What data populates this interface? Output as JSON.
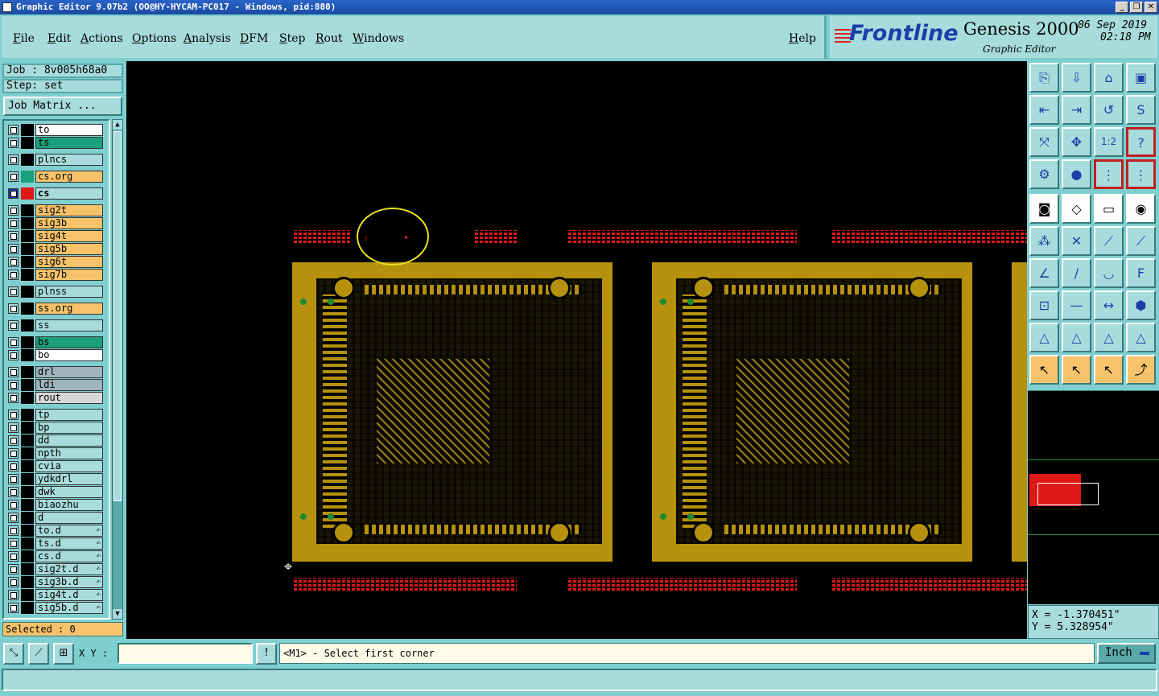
{
  "window": {
    "title": "Graphic Editor 9.07b2 (OO@HY-HYCAM-PC017 - Windows, pid:880)",
    "buttons": [
      "_",
      "❐",
      "✕"
    ]
  },
  "menu": {
    "items": [
      "File",
      "Edit",
      "Actions",
      "Options",
      "Analysis",
      "DFM",
      "Step",
      "Rout",
      "Windows"
    ],
    "help": "Help"
  },
  "brand": {
    "logo": "Frontline",
    "product": "Genesis 2000",
    "subtitle": "Graphic Editor",
    "date": "06 Sep 2019",
    "time": "02:18 PM"
  },
  "job": {
    "job_label": "Job : 8v005h68a0",
    "step_label": "Step: set",
    "matrix_button": "Job Matrix ..."
  },
  "layers": [
    {
      "name": "to",
      "color": "#ffffff",
      "swatch": "#000000"
    },
    {
      "name": "ts",
      "color": "#1aa07a",
      "swatch": "#000000"
    },
    {
      "name": "plncs",
      "color": "#a8dcdc",
      "swatch": "#000000"
    },
    {
      "name": "cs.org",
      "color": "#f6c36a",
      "swatch": "#1aa07a"
    },
    {
      "name": "cs",
      "color": "#a8dcdc",
      "swatch": "#e01818",
      "active": true
    },
    {
      "name": "sig2t",
      "color": "#f6c36a",
      "swatch": "#000000"
    },
    {
      "name": "sig3b",
      "color": "#f6c36a",
      "swatch": "#000000"
    },
    {
      "name": "sig4t",
      "color": "#f6c36a",
      "swatch": "#000000"
    },
    {
      "name": "sig5b",
      "color": "#f6c36a",
      "swatch": "#000000"
    },
    {
      "name": "sig6t",
      "color": "#f6c36a",
      "swatch": "#000000"
    },
    {
      "name": "sig7b",
      "color": "#f6c36a",
      "swatch": "#000000"
    },
    {
      "name": "plnss",
      "color": "#a8dcdc",
      "swatch": "#000000"
    },
    {
      "name": "ss.org",
      "color": "#f6c36a",
      "swatch": "#000000"
    },
    {
      "name": "ss",
      "color": "#a8dcdc",
      "swatch": "#000000"
    },
    {
      "name": "bs",
      "color": "#1aa07a",
      "swatch": "#000000"
    },
    {
      "name": "bo",
      "color": "#ffffff",
      "swatch": "#000000"
    },
    {
      "name": "drl",
      "color": "#9fb4bd",
      "swatch": "#000000"
    },
    {
      "name": "ldi",
      "color": "#9fb4bd",
      "swatch": "#000000"
    },
    {
      "name": "rout",
      "color": "#d8d8d8",
      "swatch": "#000000"
    },
    {
      "name": "tp",
      "color": "#a8dcdc",
      "swatch": "#000000"
    },
    {
      "name": "bp",
      "color": "#a8dcdc",
      "swatch": "#000000"
    },
    {
      "name": "dd",
      "color": "#a8dcdc",
      "swatch": "#000000"
    },
    {
      "name": "npth",
      "color": "#a8dcdc",
      "swatch": "#000000"
    },
    {
      "name": "cvia",
      "color": "#a8dcdc",
      "swatch": "#000000"
    },
    {
      "name": "ydkdrl",
      "color": "#a8dcdc",
      "swatch": "#000000"
    },
    {
      "name": "dwk",
      "color": "#a8dcdc",
      "swatch": "#000000"
    },
    {
      "name": "biaozhu",
      "color": "#a8dcdc",
      "swatch": "#000000"
    },
    {
      "name": "d",
      "color": "#a8dcdc",
      "swatch": "#000000"
    },
    {
      "name": "to.d",
      "color": "#a8dcdc",
      "swatch": "#000000",
      "mark": "✍"
    },
    {
      "name": "ts.d",
      "color": "#a8dcdc",
      "swatch": "#000000",
      "mark": "✍"
    },
    {
      "name": "cs.d",
      "color": "#a8dcdc",
      "swatch": "#000000",
      "mark": "✍"
    },
    {
      "name": "sig2t.d",
      "color": "#a8dcdc",
      "swatch": "#000000",
      "mark": "✍"
    },
    {
      "name": "sig3b.d",
      "color": "#a8dcdc",
      "swatch": "#000000",
      "mark": "✍"
    },
    {
      "name": "sig4t.d",
      "color": "#a8dcdc",
      "swatch": "#000000",
      "mark": "✍"
    },
    {
      "name": "sig5b.d",
      "color": "#a8dcdc",
      "swatch": "#000000",
      "mark": "✍"
    }
  ],
  "selected": "Selected : 0",
  "coords": {
    "x": "X = -1.370451\"",
    "y": "Y = 5.328954\""
  },
  "bottom": {
    "xy_label": "X Y :",
    "xy_value": "",
    "alert_icon": "!",
    "prompt": "<M1> - Select first corner",
    "units": "Inch"
  },
  "tools": [
    {
      "name": "open-job-icon",
      "glyph": "⎘"
    },
    {
      "name": "save-icon",
      "glyph": "⇩"
    },
    {
      "name": "home-icon",
      "glyph": "⌂"
    },
    {
      "name": "window-icon",
      "glyph": "▣"
    },
    {
      "name": "zoom-back-icon",
      "glyph": "⇤"
    },
    {
      "name": "zoom-forward-icon",
      "glyph": "⇥"
    },
    {
      "name": "undo-icon",
      "glyph": "↺"
    },
    {
      "name": "redo-icon",
      "glyph": "S"
    },
    {
      "name": "fit-screen-icon",
      "glyph": "⤧"
    },
    {
      "name": "center-icon",
      "glyph": "✥"
    },
    {
      "name": "one-to-two-icon",
      "glyph": "1:2"
    },
    {
      "name": "help-icon",
      "glyph": "?"
    },
    {
      "name": "settings-icon",
      "glyph": "⚙"
    },
    {
      "name": "snap-icon",
      "glyph": "●"
    },
    {
      "name": "layer-a-icon",
      "glyph": "⋮"
    },
    {
      "name": "layer-b-icon",
      "glyph": "⋮"
    },
    {
      "name": "display-icon",
      "glyph": "◙"
    },
    {
      "name": "edit-shape-icon",
      "glyph": "◇"
    },
    {
      "name": "ruler-icon",
      "glyph": "▭"
    },
    {
      "name": "pad-icon",
      "glyph": "◉"
    },
    {
      "name": "connect-icon",
      "glyph": "⁂"
    },
    {
      "name": "cross-icon",
      "glyph": "✕"
    },
    {
      "name": "line-point-icon",
      "glyph": "⟋"
    },
    {
      "name": "line-arrow-icon",
      "glyph": "⟋"
    },
    {
      "name": "angle-icon",
      "glyph": "∠"
    },
    {
      "name": "slash-icon",
      "glyph": "/"
    },
    {
      "name": "arc-icon",
      "glyph": "◡"
    },
    {
      "name": "text-icon",
      "glyph": "F"
    },
    {
      "name": "dual-pad-icon",
      "glyph": "⊡"
    },
    {
      "name": "horizontal-line-icon",
      "glyph": "—"
    },
    {
      "name": "measure-icon",
      "glyph": "↔"
    },
    {
      "name": "shapes-icon",
      "glyph": "⬢"
    },
    {
      "name": "triangle-a-icon",
      "glyph": "△"
    },
    {
      "name": "triangle-b-icon",
      "glyph": "△"
    },
    {
      "name": "triangle-c-icon",
      "glyph": "△"
    },
    {
      "name": "triangle-d-icon",
      "glyph": "△"
    },
    {
      "name": "select-arrow-icon",
      "glyph": "↖"
    },
    {
      "name": "select-box-icon",
      "glyph": "↖"
    },
    {
      "name": "select-area-icon",
      "glyph": "↖"
    },
    {
      "name": "select-path-icon",
      "glyph": "⤴"
    }
  ]
}
